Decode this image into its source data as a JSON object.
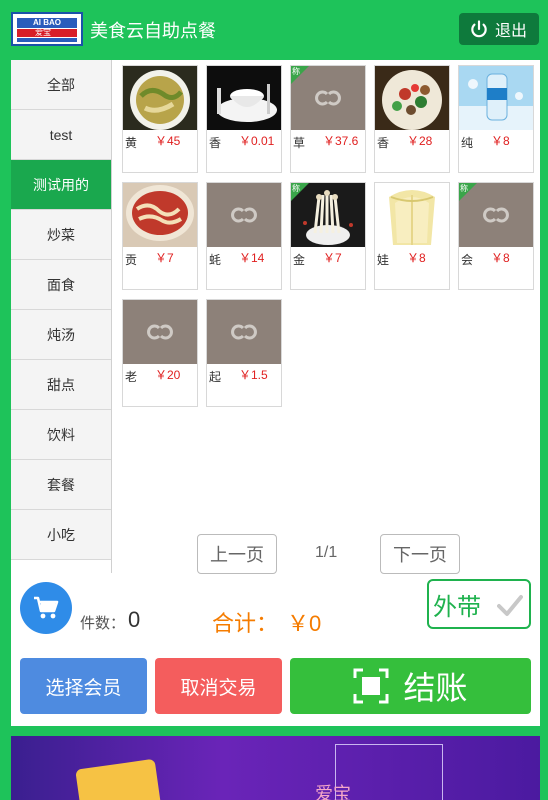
{
  "header": {
    "logo_text": "AI BAO",
    "logo_cn": "爱宝",
    "title": "美食云自助点餐",
    "exit_label": "退出"
  },
  "sidebar": {
    "categories": [
      {
        "label": "全部"
      },
      {
        "label": "test"
      },
      {
        "label": "测试用的",
        "active": true
      },
      {
        "label": "炒菜"
      },
      {
        "label": "面食"
      },
      {
        "label": "炖汤"
      },
      {
        "label": "甜点"
      },
      {
        "label": "饮料"
      },
      {
        "label": "套餐"
      },
      {
        "label": "小吃"
      }
    ]
  },
  "items": [
    {
      "name": "黄",
      "price": "￥45",
      "image": "fish-dish"
    },
    {
      "name": "香",
      "price": "￥0.01",
      "image": "tableware"
    },
    {
      "name": "草",
      "price": "￥37.6",
      "image": "placeholder",
      "tag": "称"
    },
    {
      "name": "香",
      "price": "￥28",
      "image": "stir-fry"
    },
    {
      "name": "纯",
      "price": "￥8",
      "image": "water-bottle"
    },
    {
      "name": "贡",
      "price": "￥7",
      "image": "noodle-soup"
    },
    {
      "name": "蚝",
      "price": "￥14",
      "image": "placeholder"
    },
    {
      "name": "金",
      "price": "￥7",
      "image": "enoki",
      "tag": "称"
    },
    {
      "name": "娃",
      "price": "￥8",
      "image": "cabbage"
    },
    {
      "name": "会",
      "price": "￥8",
      "image": "placeholder",
      "tag": "称"
    },
    {
      "name": "老",
      "price": "￥20",
      "image": "placeholder"
    },
    {
      "name": "起",
      "price": "￥1.5",
      "image": "placeholder"
    }
  ],
  "pager": {
    "prev_label": "上一页",
    "page": "1/1",
    "next_label": "下一页"
  },
  "summary": {
    "count_label": "件数：",
    "count_value": "0",
    "total_label": "合计：",
    "total_value": "￥0",
    "takeaway_label": "外带"
  },
  "actions": {
    "member_label": "选择会员",
    "cancel_label": "取消交易",
    "pay_label": "结账"
  },
  "banner": {
    "brand_text": "爱宝"
  },
  "colors": {
    "brand_green": "#1ec35a",
    "active_category": "#1aa84e",
    "price_red": "#e02020",
    "total_orange": "#f57c00",
    "member_blue": "#4e8be0",
    "cancel_red": "#f45d5d",
    "pay_green": "#35bf3c"
  }
}
